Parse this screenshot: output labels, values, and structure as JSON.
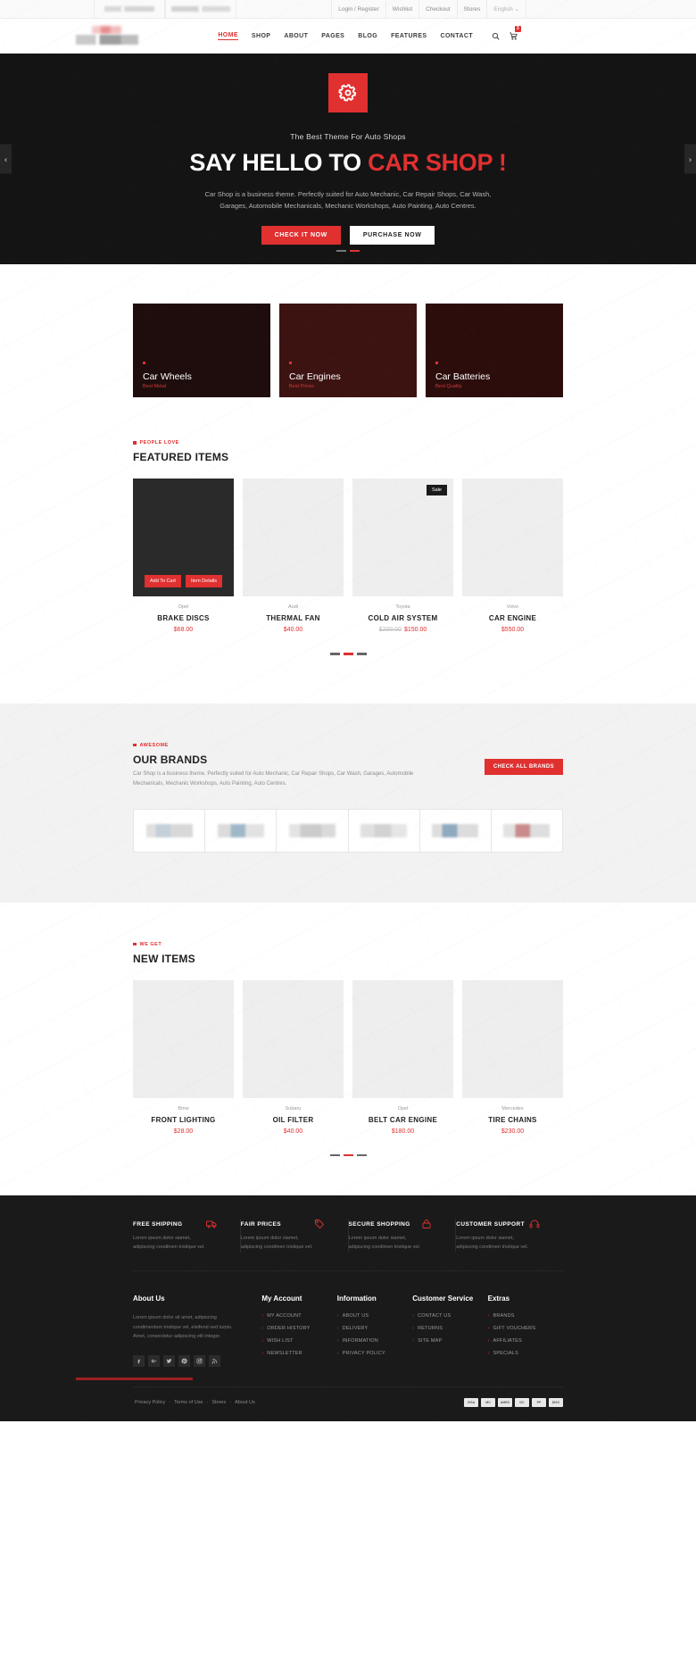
{
  "topbar": {
    "links": [
      "Login / Register",
      "Wishlist",
      "Checkout",
      "Stores"
    ],
    "language": "English"
  },
  "header": {
    "nav": [
      {
        "label": "HOME",
        "active": true
      },
      {
        "label": "SHOP",
        "active": false
      },
      {
        "label": "ABOUT",
        "active": false
      },
      {
        "label": "PAGES",
        "active": false
      },
      {
        "label": "BLOG",
        "active": false
      },
      {
        "label": "FEATURES",
        "active": false
      },
      {
        "label": "CONTACT",
        "active": false
      }
    ],
    "cart_count": "3"
  },
  "hero": {
    "subtitle": "The Best Theme For Auto Shops",
    "title_plain": "SAY HELLO TO ",
    "title_highlight": "CAR SHOP !",
    "description": "Car Shop is a business theme. Perfectly suited for Auto Mechanic, Car Repair Shops, Car Wash, Garages, Automobile Mechanicals, Mechanic Workshops, Auto Painting, Auto Centres.",
    "primary_button": "CHECK IT NOW",
    "secondary_button": "PURCHASE NOW",
    "slide_count": 2,
    "active_slide": 2
  },
  "categories": [
    {
      "title": "Car Wheels",
      "subtitle": "Best Metal"
    },
    {
      "title": "Car Engines",
      "subtitle": "Best Prices"
    },
    {
      "title": "Car Batteries",
      "subtitle": "Best Quality"
    }
  ],
  "featured": {
    "kicker": "PEOPLE LOVE",
    "title": "FEATURED ITEMS",
    "add_to_cart_label": "Add To Cart",
    "item_details_label": "Item Details",
    "sale_label": "Sale",
    "items": [
      {
        "brand": "Opel",
        "name": "BRAKE DISCS",
        "price": "$68.00",
        "old_price": "",
        "sale": false,
        "hovered": true
      },
      {
        "brand": "Audi",
        "name": "THERMAL FAN",
        "price": "$40.00",
        "old_price": "",
        "sale": false,
        "hovered": false
      },
      {
        "brand": "Toyota",
        "name": "COLD AIR SYSTEM",
        "price": "$150.00",
        "old_price": "$200.00",
        "sale": true,
        "hovered": false
      },
      {
        "brand": "Volvo",
        "name": "CAR ENGINE",
        "price": "$550.00",
        "old_price": "",
        "sale": false,
        "hovered": false
      }
    ],
    "dots": 3,
    "active_dot": 2
  },
  "brands": {
    "kicker": "AWESOME",
    "title": "OUR BRANDS",
    "description": "Car Shop is a business theme. Perfectly suited for Auto Mechanic, Car Repair Shops, Car Wash, Garages, Automobile Mechanicals, Mechanic Workshops, Auto Painting, Auto Centres.",
    "button": "CHECK ALL BRANDS",
    "logo_count": 6
  },
  "newitems": {
    "kicker": "WE GET",
    "title": "NEW ITEMS",
    "items": [
      {
        "brand": "Bmw",
        "name": "FRONT LIGHTING",
        "price": "$28.00",
        "old_price": ""
      },
      {
        "brand": "Subaru",
        "name": "OIL FILTER",
        "price": "$40.00",
        "old_price": ""
      },
      {
        "brand": "Opel",
        "name": "BELT CAR ENGINE",
        "price": "$180.00",
        "old_price": ""
      },
      {
        "brand": "Mercedes",
        "name": "TIRE CHAINS",
        "price": "$230.00",
        "old_price": ""
      }
    ],
    "dots": 3,
    "active_dot": 2
  },
  "footer": {
    "features": [
      {
        "title": "FREE SHIPPING",
        "text": "Lorem ipsum dolor siamet, adipiscing condimen tristique vel.",
        "icon": "truck-icon"
      },
      {
        "title": "FAIR PRICES",
        "text": "Lorem ipsum dolor siamet, adipiscing condimen tristique vel.",
        "icon": "tag-icon"
      },
      {
        "title": "SECURE SHOPPING",
        "text": "Lorem ipsum dolor siamet, adipiscing condimen tristique vel.",
        "icon": "lock-icon"
      },
      {
        "title": "CUSTOMER SUPPORT",
        "text": "Lorem ipsum dolor siamet, adipiscing condimen tristique vel.",
        "icon": "headset-icon"
      }
    ],
    "about": {
      "title": "About Us",
      "text": "Lorem ipsum dolor sit amet, adipiscing condimentum tristique vel, eleifend sed turpis. Amet, consectetur adipiscing elit integer.",
      "socials": [
        "facebook-icon",
        "google-plus-icon",
        "twitter-icon",
        "pinterest-icon",
        "instagram-icon",
        "rss-icon"
      ]
    },
    "columns": [
      {
        "title": "My Account",
        "links": [
          "MY ACCOUNT",
          "ORDER HISTORY",
          "WISH LIST",
          "NEWSLETTER"
        ]
      },
      {
        "title": "Information",
        "links": [
          "ABOUT US",
          "DELIVERY",
          "INFORMATION",
          "PRIVACY POLICY"
        ]
      },
      {
        "title": "Customer Service",
        "links": [
          "CONTACT US",
          "RETURNS",
          "SITE MAP"
        ]
      },
      {
        "title": "Extras",
        "links": [
          "BRANDS",
          "GIFT VOUCHERS",
          "AFFILIATES",
          "SPECIALS"
        ]
      }
    ],
    "bottom_links": [
      "Privacy Policy",
      "Terms of Use",
      "Stores",
      "About Us"
    ],
    "payments": [
      "VISA",
      "MC",
      "AMEX",
      "DC",
      "PP",
      "DISC"
    ]
  },
  "colors": {
    "accent": "#e03030",
    "dark": "#1a1a1a",
    "hero_bg": "#141414",
    "muted": "#8d8d8d"
  }
}
